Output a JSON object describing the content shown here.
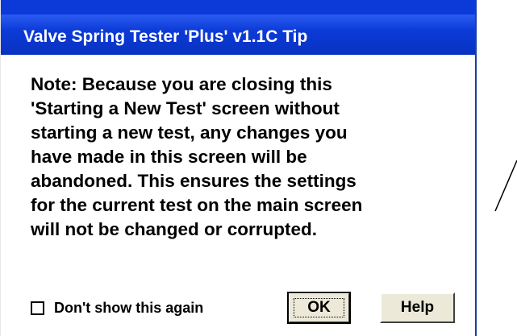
{
  "window": {
    "title": "Valve Spring Tester 'Plus' v1.1C Tip"
  },
  "message": {
    "lines": [
      "Note:  Because you are closing this",
      "'Starting a New Test' screen without",
      "starting a new test, any changes you",
      "have made in this screen will be",
      "abandoned.  This ensures the settings",
      "for the current test on the main screen",
      "will not be changed or corrupted."
    ]
  },
  "footer": {
    "checkbox_label": "Don't show this again",
    "checkbox_checked": false,
    "ok_label": "OK",
    "help_label": "Help"
  },
  "colors": {
    "title_bar": "#0a36c8",
    "title_text": "#ffffff",
    "dialog_face": "#ece9d8",
    "content_background": "#ffffff"
  }
}
